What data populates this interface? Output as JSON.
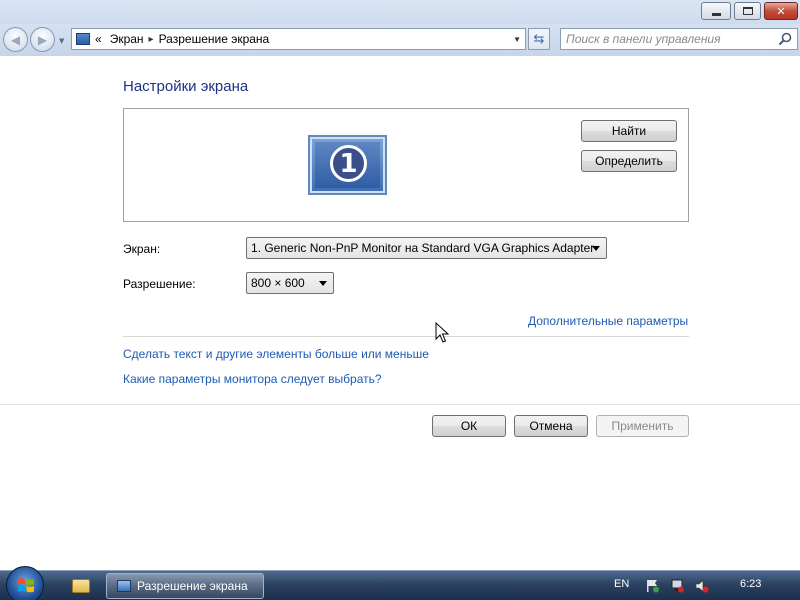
{
  "window": {
    "title_buttons": {
      "minimize": "minimize-icon",
      "maximize": "maximize-icon",
      "close": "close-icon"
    }
  },
  "navigation": {
    "breadcrumb_prefix": "«",
    "breadcrumb": [
      "Экран",
      "Разрешение экрана"
    ],
    "separator": "▸",
    "search_placeholder": "Поиск в панели управления"
  },
  "page": {
    "heading": "Настройки экрана",
    "monitor_number": "1",
    "find_button": "Найти",
    "identify_button": "Определить",
    "screen_label": "Экран:",
    "screen_value": "1. Generic Non-PnP Monitor на Standard VGA Graphics Adapter",
    "resolution_label": "Разрешение:",
    "resolution_value": "800 × 600",
    "advanced_link": "Дополнительные параметры",
    "text_size_link": "Сделать текст и другие элементы больше или меньше",
    "monitor_help_link": "Какие параметры монитора следует выбрать?",
    "ok_button": "ОК",
    "cancel_button": "Отмена",
    "apply_button": "Применить"
  },
  "taskbar": {
    "task_label": "Разрешение экрана",
    "language": "EN",
    "time": "6:23"
  },
  "colors": {
    "link": "#1e5bb3",
    "heading": "#1e3287",
    "taskbar": "#2b4262"
  }
}
